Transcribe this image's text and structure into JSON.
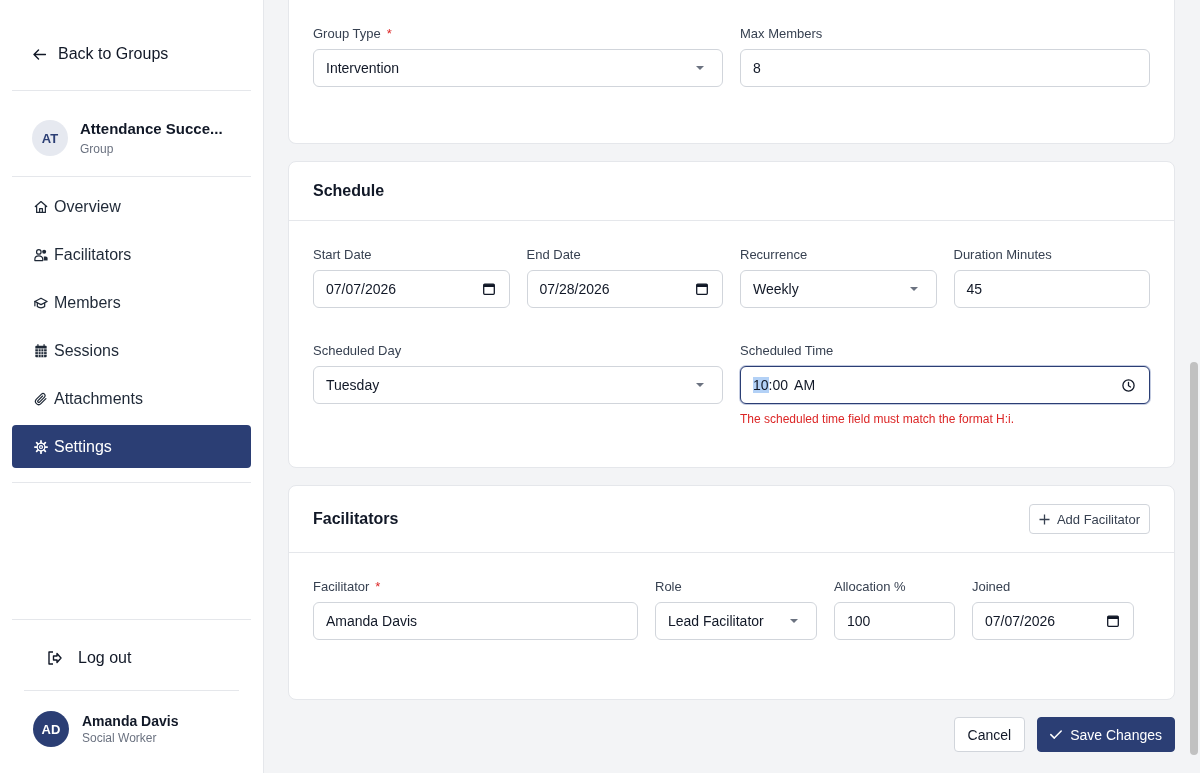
{
  "sidebar": {
    "back_link": {
      "label": "Back to Groups"
    },
    "group": {
      "initials": "AT",
      "name": "Attendance Succe...",
      "subtitle": "Group"
    },
    "nav": [
      {
        "label": "Overview",
        "selected": false
      },
      {
        "label": "Facilitators",
        "selected": false
      },
      {
        "label": "Members",
        "selected": false
      },
      {
        "label": "Sessions",
        "selected": false
      },
      {
        "label": "Attachments",
        "selected": false
      },
      {
        "label": "Settings",
        "selected": true
      }
    ],
    "logout": {
      "label": "Log out"
    },
    "user": {
      "initials": "AD",
      "name": "Amanda Davis",
      "role": "Social Worker"
    }
  },
  "sections": [
    {
      "fields": [
        {
          "kind": "select",
          "label": "Group Type",
          "required_mark": "*",
          "value": "Intervention",
          "focused": false
        },
        {
          "kind": "text",
          "label": "Max Members",
          "value": "8",
          "focused": false
        }
      ]
    },
    {
      "title": "Schedule",
      "fields": [
        {
          "kind": "date",
          "label": "Start Date",
          "value": "07/07/2026",
          "focused": false
        },
        {
          "kind": "date",
          "label": "End Date",
          "value": "07/28/2026",
          "focused": false
        },
        {
          "kind": "select",
          "label": "Recurrence",
          "value": "Weekly",
          "focused": false
        },
        {
          "kind": "text",
          "label": "Duration Minutes",
          "value": "45",
          "focused": false
        },
        {
          "kind": "select",
          "label": "Scheduled Day",
          "value": "Tuesday",
          "focused": false
        },
        {
          "kind": "time",
          "label": "Scheduled Time",
          "focused": true,
          "segments": [
            {
              "text": "10",
              "selected": true
            },
            {
              "text": ":00",
              "selected": false
            },
            {
              "text": "AM",
              "selected": false
            }
          ],
          "error": "The scheduled time field must match the format H:i."
        }
      ]
    },
    {
      "title": "Facilitators",
      "action": {
        "label": "Add Facilitator"
      },
      "fields": [
        {
          "kind": "text",
          "label": "Facilitator",
          "required_mark": "*",
          "value": "Amanda Davis",
          "focused": false
        },
        {
          "kind": "select",
          "label": "Role",
          "value": "Lead Facilitator",
          "focused": false
        },
        {
          "kind": "text",
          "label": "Allocation %",
          "value": "100",
          "focused": false
        },
        {
          "kind": "date",
          "label": "Joined",
          "value": "07/07/2026",
          "focused": false
        }
      ]
    }
  ],
  "actions": [
    {
      "kind": "secondary",
      "label": "Cancel"
    },
    {
      "kind": "primary",
      "label": "Save Changes"
    }
  ]
}
